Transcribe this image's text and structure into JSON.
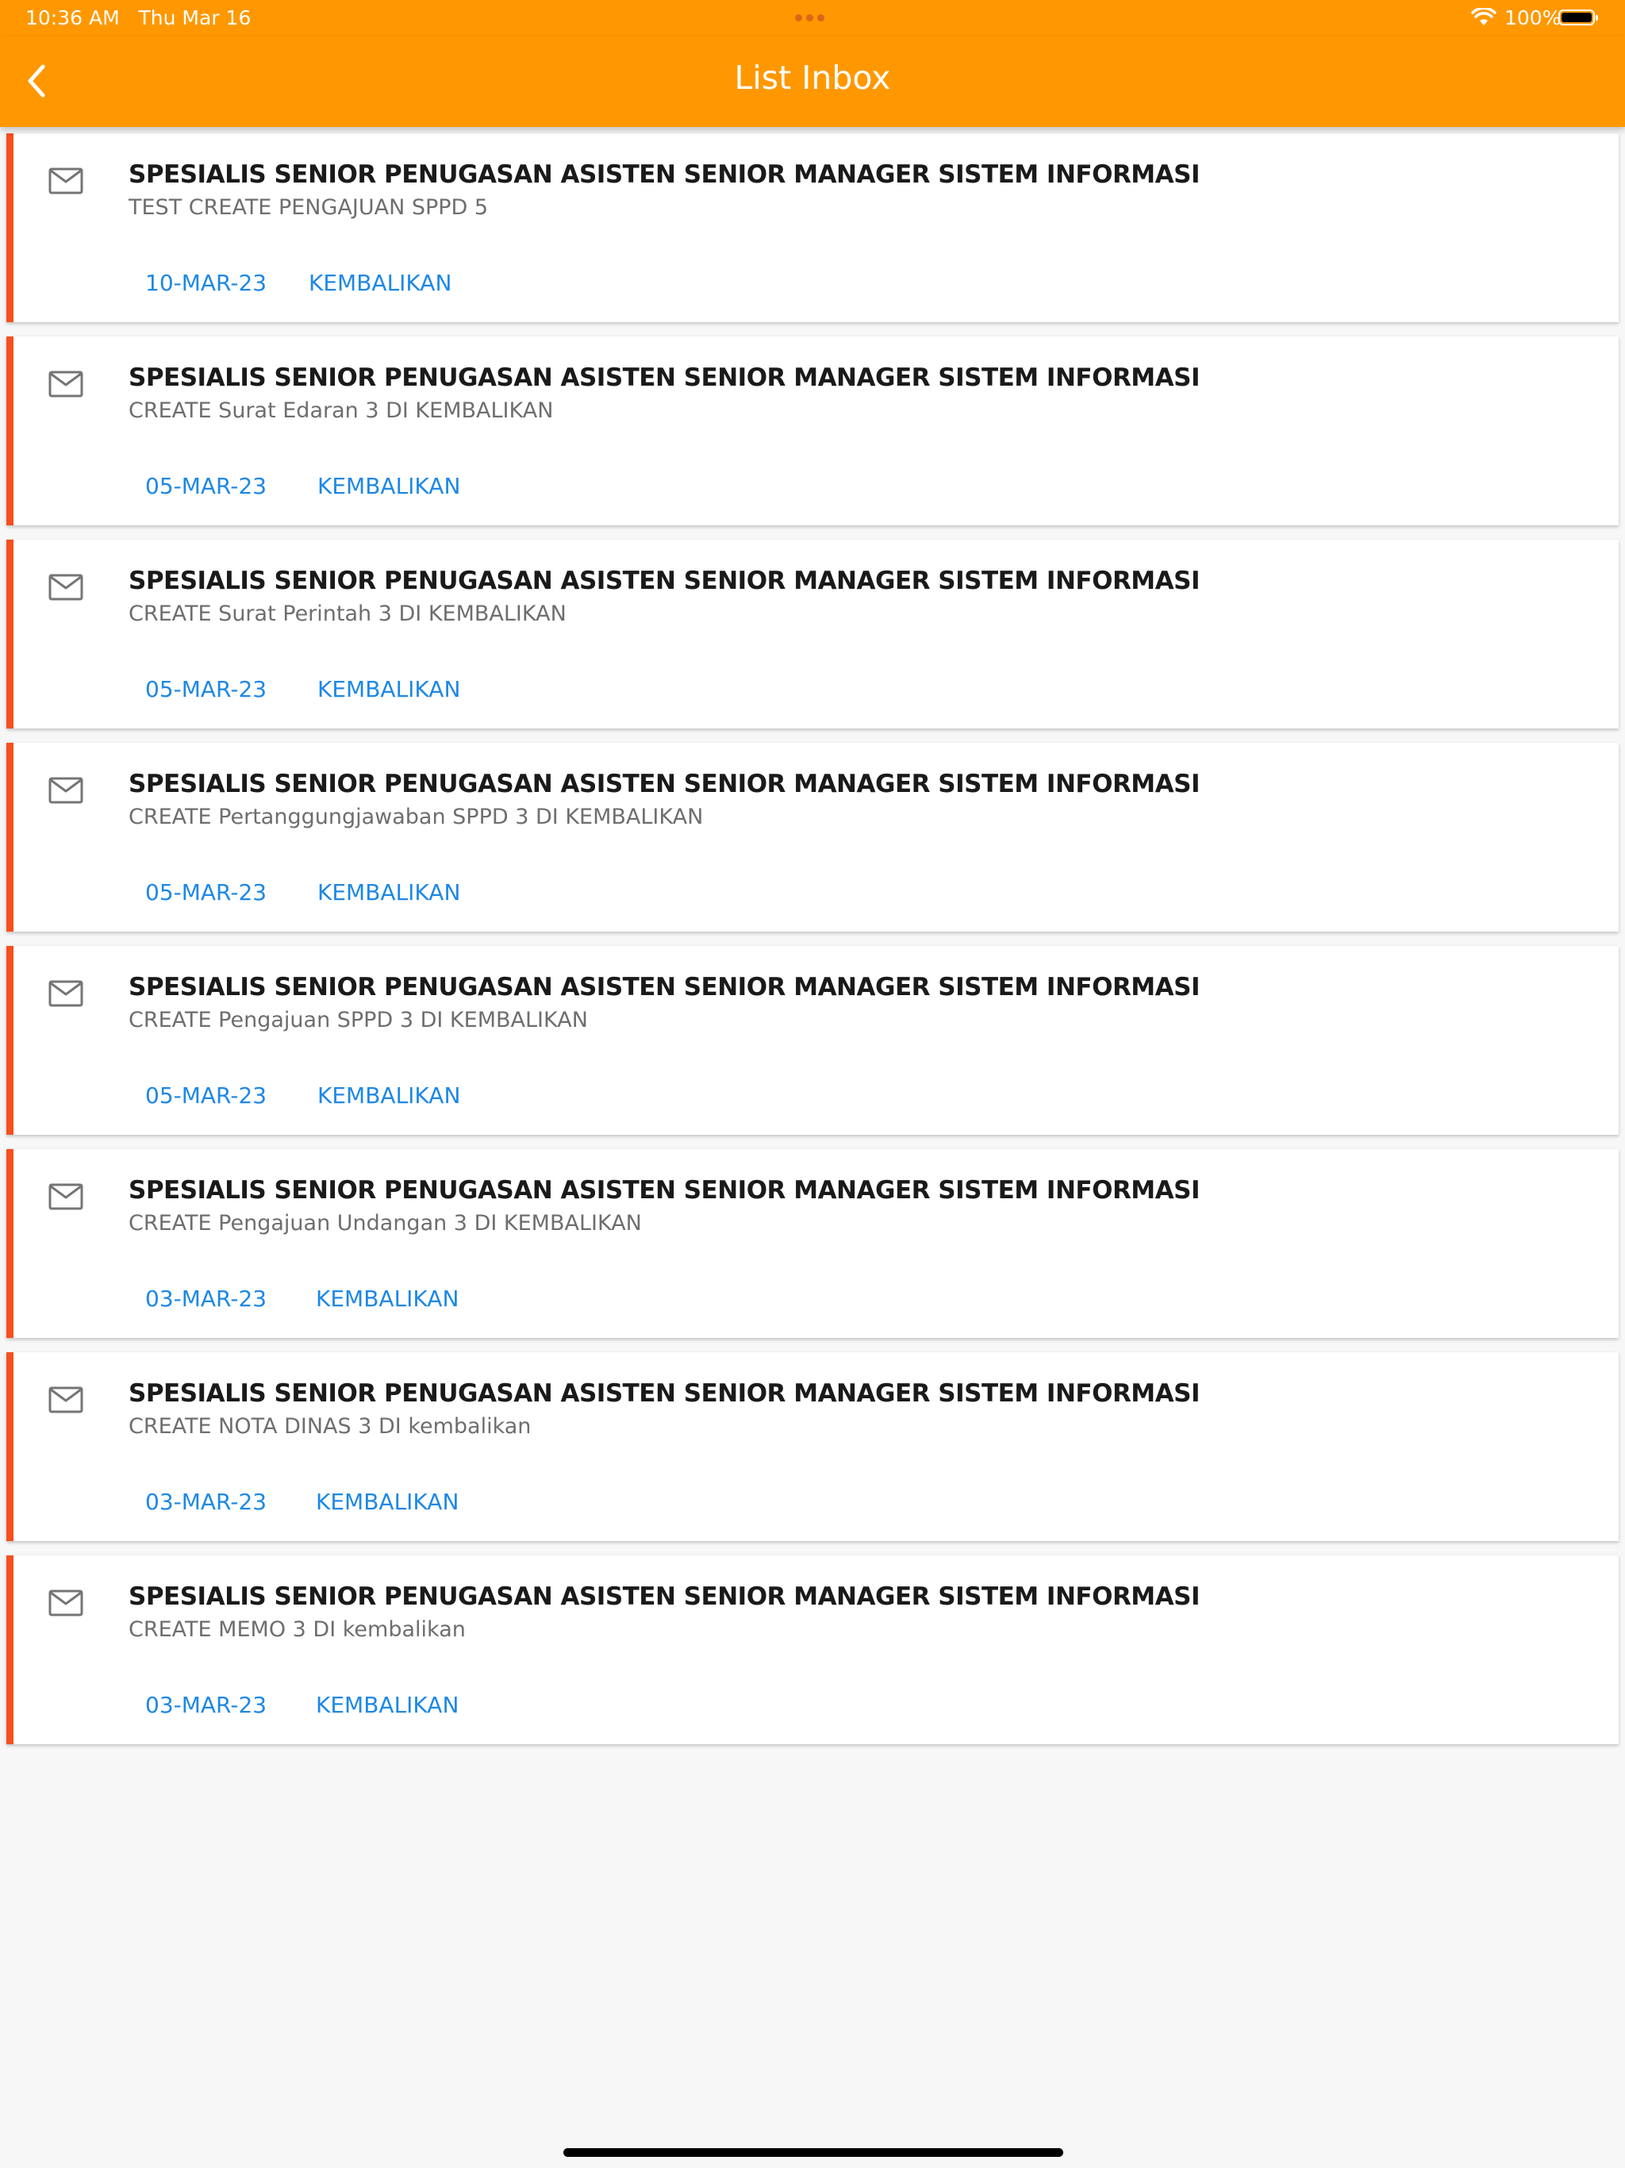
{
  "status_bar": {
    "time": "10:36 AM",
    "date": "Thu Mar 16",
    "battery": "100%"
  },
  "app_bar": {
    "title": "List Inbox",
    "back_icon": "chevron-left-icon"
  },
  "colors": {
    "header": "#ff9800",
    "card_accent": "#f4511e",
    "link": "#1e88e5"
  },
  "inbox": [
    {
      "title": "SPESIALIS SENIOR PENUGASAN ASISTEN SENIOR MANAGER SISTEM INFORMASI",
      "subtitle": "TEST CREATE PENGAJUAN SPPD 5",
      "date": "10-MAR-23",
      "action": "KEMBALIKAN",
      "icon": "mail-icon"
    },
    {
      "title": "SPESIALIS SENIOR PENUGASAN ASISTEN SENIOR MANAGER SISTEM INFORMASI",
      "subtitle": "CREATE Surat Edaran 3 DI KEMBALIKAN",
      "date": "05-MAR-23",
      "action": "KEMBALIKAN",
      "icon": "mail-icon"
    },
    {
      "title": "SPESIALIS SENIOR PENUGASAN ASISTEN SENIOR MANAGER SISTEM INFORMASI",
      "subtitle": "CREATE Surat Perintah 3 DI KEMBALIKAN",
      "date": "05-MAR-23",
      "action": "KEMBALIKAN",
      "icon": "mail-icon"
    },
    {
      "title": "SPESIALIS SENIOR PENUGASAN ASISTEN SENIOR MANAGER SISTEM INFORMASI",
      "subtitle": "CREATE Pertanggungjawaban SPPD 3 DI KEMBALIKAN",
      "date": "05-MAR-23",
      "action": "KEMBALIKAN",
      "icon": "mail-icon"
    },
    {
      "title": "SPESIALIS SENIOR PENUGASAN ASISTEN SENIOR MANAGER SISTEM INFORMASI",
      "subtitle": "CREATE Pengajuan SPPD 3 DI KEMBALIKAN",
      "date": "05-MAR-23",
      "action": "KEMBALIKAN",
      "icon": "mail-icon"
    },
    {
      "title": "SPESIALIS SENIOR PENUGASAN ASISTEN SENIOR MANAGER SISTEM INFORMASI",
      "subtitle": "CREATE Pengajuan Undangan 3 DI KEMBALIKAN",
      "date": "03-MAR-23",
      "action": "KEMBALIKAN",
      "icon": "mail-icon"
    },
    {
      "title": "SPESIALIS SENIOR PENUGASAN ASISTEN SENIOR MANAGER SISTEM INFORMASI",
      "subtitle": "CREATE NOTA DINAS 3 DI kembalikan",
      "date": "03-MAR-23",
      "action": "KEMBALIKAN",
      "icon": "mail-icon"
    },
    {
      "title": "SPESIALIS SENIOR PENUGASAN ASISTEN SENIOR MANAGER SISTEM INFORMASI",
      "subtitle": "CREATE MEMO 3 DI kembalikan",
      "date": "03-MAR-23",
      "action": "KEMBALIKAN",
      "icon": "mail-icon"
    }
  ]
}
